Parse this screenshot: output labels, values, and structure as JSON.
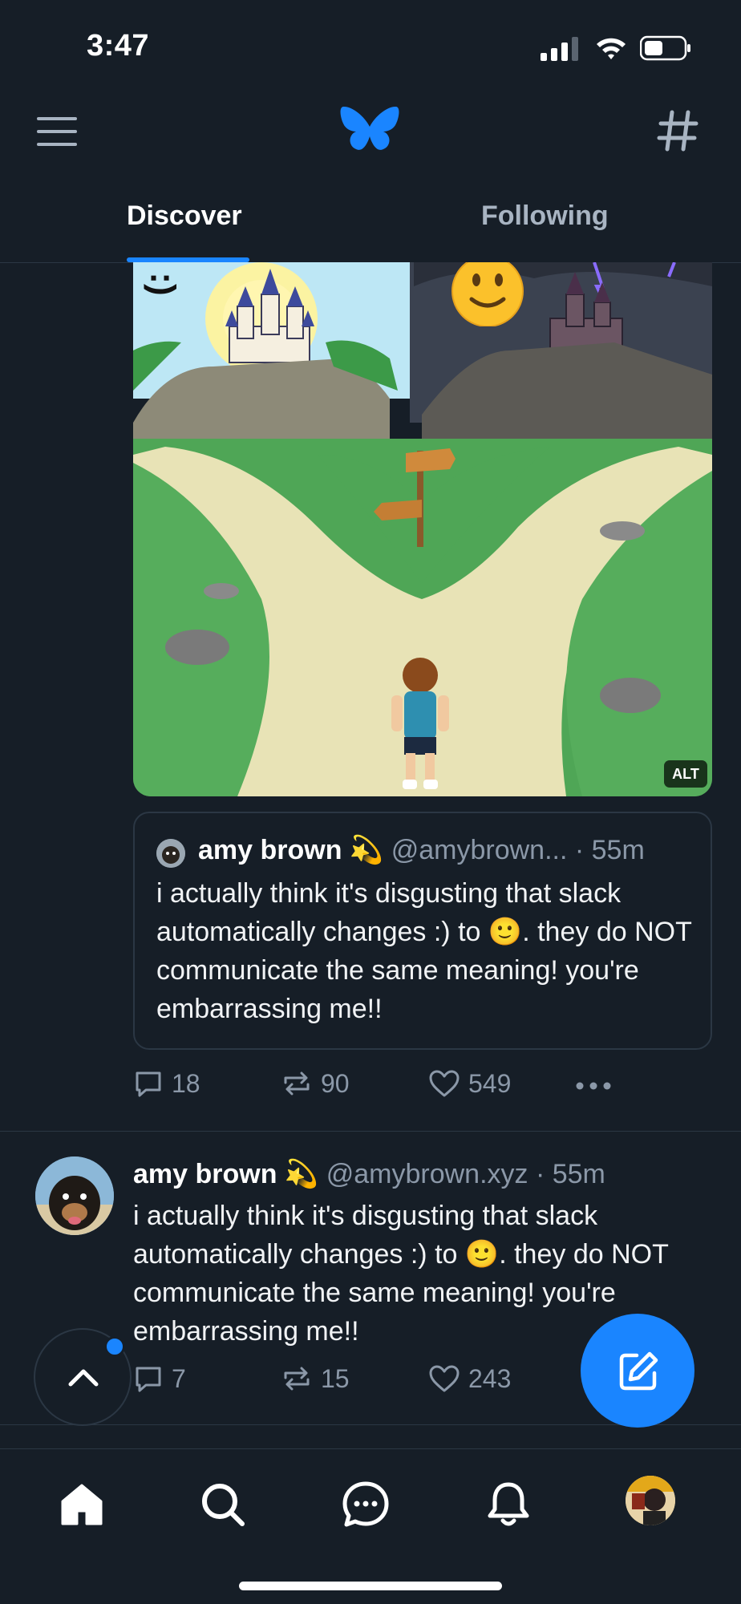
{
  "status_bar": {
    "time": "3:47"
  },
  "header": {
    "logo_icon": "butterfly-icon",
    "menu_icon": "menu-icon",
    "feeds_icon": "hash-icon"
  },
  "tabs": [
    {
      "label": "Discover",
      "active": true
    },
    {
      "label": "Following",
      "active": false
    }
  ],
  "post1": {
    "image_alt_badge": "ALT",
    "image_text": ":)",
    "quote": {
      "name": "amy brown 💫",
      "handle": "@amybrown...",
      "time": "· 55m",
      "text": "i actually think it's disgusting that slack automatically changes :) to 🙂. they do NOT communicate the same meaning! you're embarrassing me!!"
    },
    "actions": {
      "replies": "18",
      "reposts": "90",
      "likes": "549"
    }
  },
  "post2": {
    "name": "amy brown 💫",
    "handle": "@amybrown.xyz",
    "time": "· 55m",
    "text": "i actually think it's disgusting that slack automatically changes :) to 🙂. they do NOT communicate the same meaning! you're embarrassing me!!",
    "actions": {
      "replies": "7",
      "reposts": "15",
      "likes": "243"
    }
  },
  "colors": {
    "accent": "#1a85ff",
    "background": "#161e27",
    "muted": "#8b98a8"
  },
  "nav": [
    "home-icon",
    "search-icon",
    "chat-icon",
    "bell-icon",
    "profile-avatar"
  ]
}
